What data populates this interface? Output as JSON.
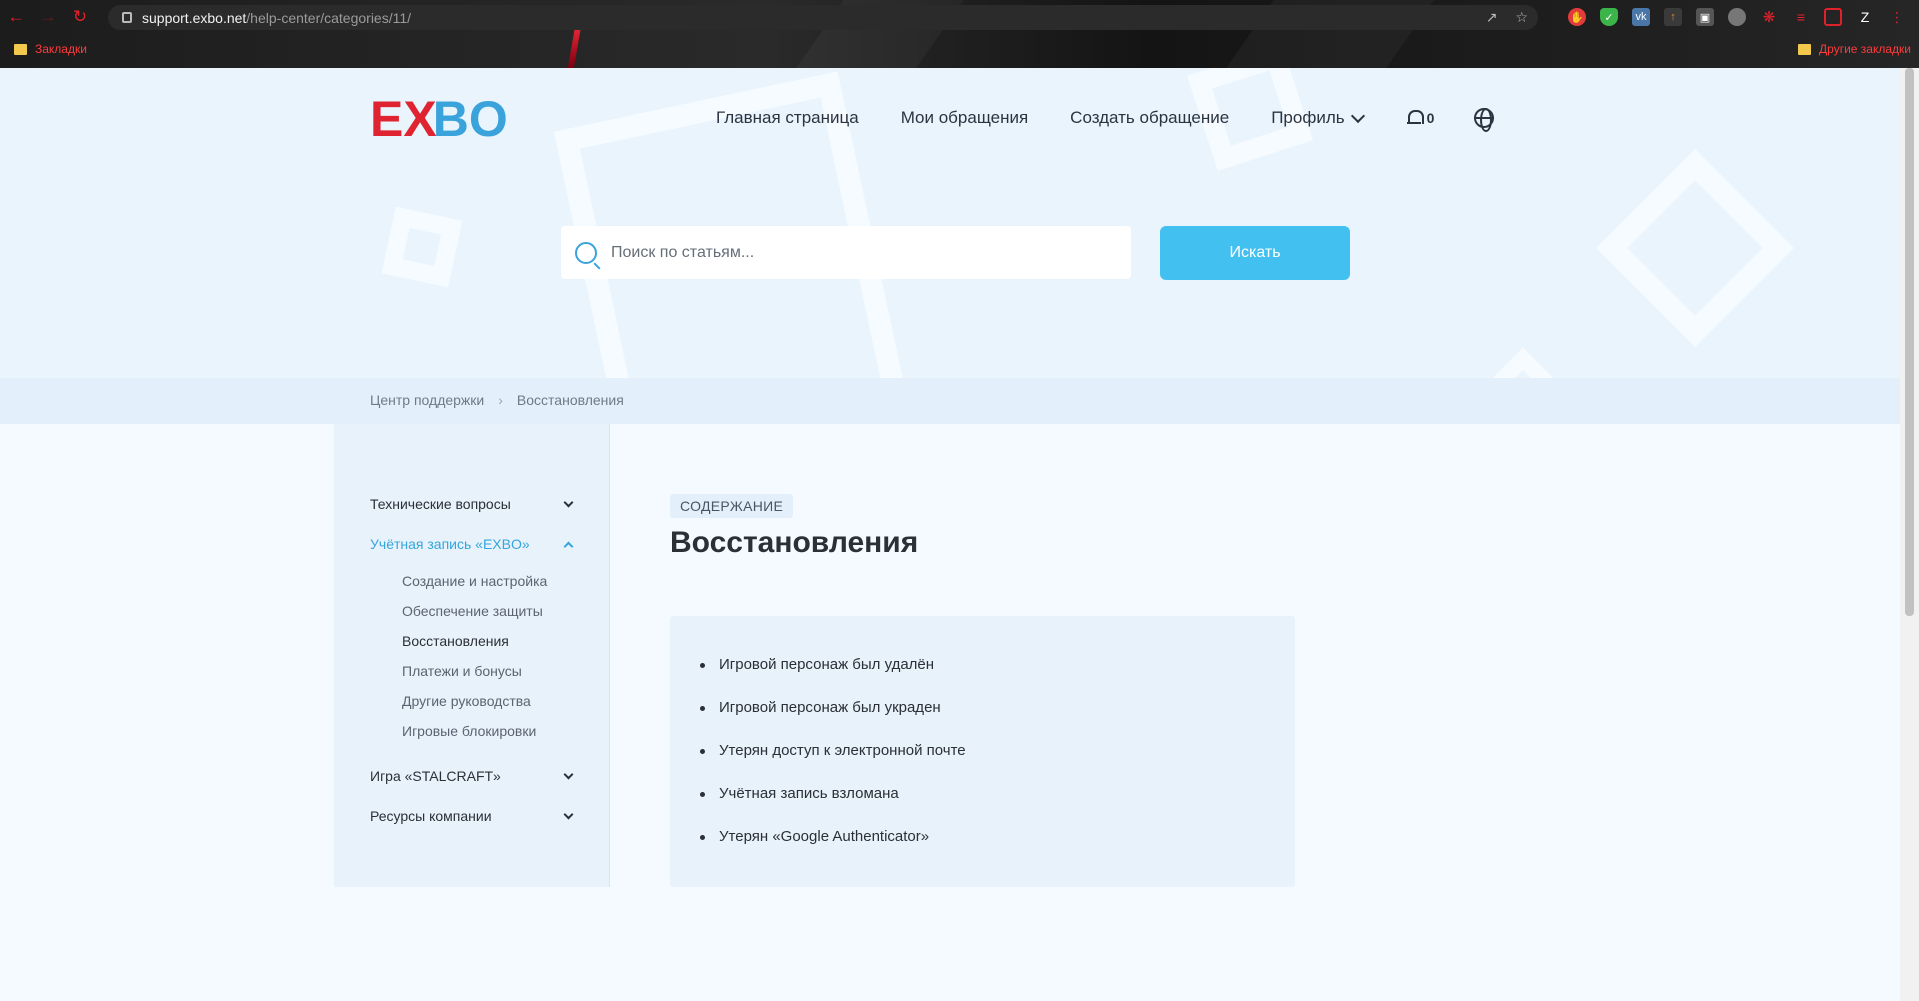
{
  "browser": {
    "url_host": "support.exbo.net",
    "url_path": "/help-center/categories/11/",
    "bookmarks_left": "Закладки",
    "bookmarks_right": "Другие закладки"
  },
  "header": {
    "logo_text_e": "E",
    "logo_text_x": "X",
    "logo_text_bo": "BO",
    "nav": {
      "home": "Главная страница",
      "my_requests": "Мои обращения",
      "create_request": "Создать обращение",
      "profile": "Профиль"
    },
    "notification_count": "0"
  },
  "search": {
    "placeholder": "Поиск по статьям...",
    "button_label": "Искать"
  },
  "breadcrumb": {
    "items": [
      "Центр поддержки",
      "Восстановления"
    ],
    "separator": "›"
  },
  "sidebar": {
    "categories": [
      {
        "label": "Технические вопросы"
      },
      {
        "label": "Учётная запись «EXBO»",
        "active": true
      },
      {
        "label": "Игра «STALCRAFT»"
      },
      {
        "label": "Ресурсы компании"
      }
    ],
    "subitems": [
      "Создание и настройка",
      "Обеспечение защиты",
      "Восстановления",
      "Платежи и бонусы",
      "Другие руководства",
      "Игровые блокировки"
    ]
  },
  "main": {
    "tag": "СОДЕРЖАНИЕ",
    "title": "Восстановления",
    "articles": [
      "Игровой персонаж был удалён",
      "Игровой персонаж был украден",
      "Утерян доступ к электронной почте",
      "Учётная запись взломана",
      "Утерян «Google Authenticator»"
    ]
  },
  "colors": {
    "brand_red": "#e02331",
    "brand_blue": "#3aa3dc",
    "accent_button": "#42c1f1",
    "active_link": "#36a5dd"
  }
}
